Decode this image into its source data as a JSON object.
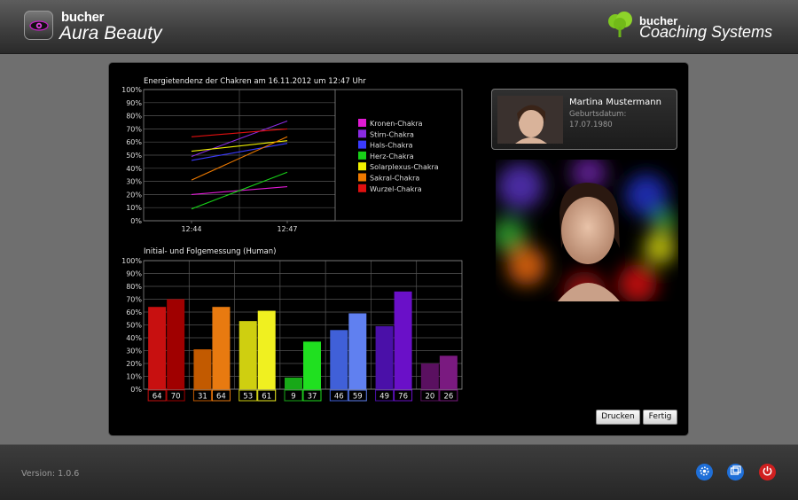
{
  "header": {
    "brand_small": "bucher",
    "brand_big": "Aura Beauty",
    "company_small": "bucher",
    "company_big": "Coaching Systems"
  },
  "chart_data": [
    {
      "type": "line",
      "title": "Energietendenz der Chakren am 16.11.2012 um 12:47 Uhr",
      "categories": [
        "12:44",
        "12:47"
      ],
      "y_ticks": [
        "100%",
        "90%",
        "80%",
        "70%",
        "60%",
        "50%",
        "40%",
        "30%",
        "20%",
        "10%",
        "0%"
      ],
      "ylim": [
        0,
        100
      ],
      "legend_position": "right",
      "grid": true,
      "series": [
        {
          "name": "Kronen-Chakra",
          "color": "#e01ad4",
          "values": [
            20,
            26
          ]
        },
        {
          "name": "Stirn-Chakra",
          "color": "#8a2be2",
          "values": [
            49,
            76
          ]
        },
        {
          "name": "Hals-Chakra",
          "color": "#3b3bff",
          "values": [
            46,
            59
          ]
        },
        {
          "name": "Herz-Chakra",
          "color": "#18d018",
          "values": [
            9,
            37
          ]
        },
        {
          "name": "Solarplexus-Chakra",
          "color": "#f0f000",
          "values": [
            53,
            61
          ]
        },
        {
          "name": "Sakral-Chakra",
          "color": "#ee7a00",
          "values": [
            31,
            64
          ]
        },
        {
          "name": "Wurzel-Chakra",
          "color": "#e01010",
          "values": [
            64,
            70
          ]
        }
      ]
    },
    {
      "type": "bar",
      "title": "Initial- und Folgemessung (Human)",
      "y_ticks": [
        "100%",
        "90%",
        "80%",
        "70%",
        "60%",
        "50%",
        "40%",
        "30%",
        "20%",
        "10%",
        "0%"
      ],
      "ylim": [
        0,
        100
      ],
      "grid": true,
      "groups": [
        {
          "values": [
            64,
            70
          ],
          "labels": [
            "64",
            "70"
          ],
          "c1": "#c81010",
          "c2": "#a00000"
        },
        {
          "values": [
            31,
            64
          ],
          "labels": [
            "31",
            "64"
          ],
          "c1": "#c25a00",
          "c2": "#e87a10"
        },
        {
          "values": [
            53,
            61
          ],
          "labels": [
            "53",
            "61"
          ],
          "c1": "#cfcf10",
          "c2": "#f0f020"
        },
        {
          "values": [
            9,
            37
          ],
          "labels": [
            "9",
            "37"
          ],
          "c1": "#18a818",
          "c2": "#20e020"
        },
        {
          "values": [
            46,
            59
          ],
          "labels": [
            "46",
            "59"
          ],
          "c1": "#4060d8",
          "c2": "#6080f0"
        },
        {
          "values": [
            49,
            76
          ],
          "labels": [
            "49",
            "76"
          ],
          "c1": "#4a10a8",
          "c2": "#6a10c8"
        },
        {
          "values": [
            20,
            26
          ],
          "labels": [
            "20",
            "26"
          ],
          "c1": "#5a1060",
          "c2": "#7a1a80"
        }
      ]
    }
  ],
  "person": {
    "name": "Martina Mustermann",
    "birth_label": "Geburtsdatum:",
    "birth_date": "17.07.1980"
  },
  "buttons": {
    "print": "Drucken",
    "done": "Fertig"
  },
  "footer": {
    "version": "Version: 1.0.6"
  },
  "colors": {
    "settings": "#1f6fd8",
    "window": "#1f6fd8",
    "power": "#d02020"
  },
  "icons": [
    "settings-icon",
    "window-icon",
    "power-icon"
  ]
}
